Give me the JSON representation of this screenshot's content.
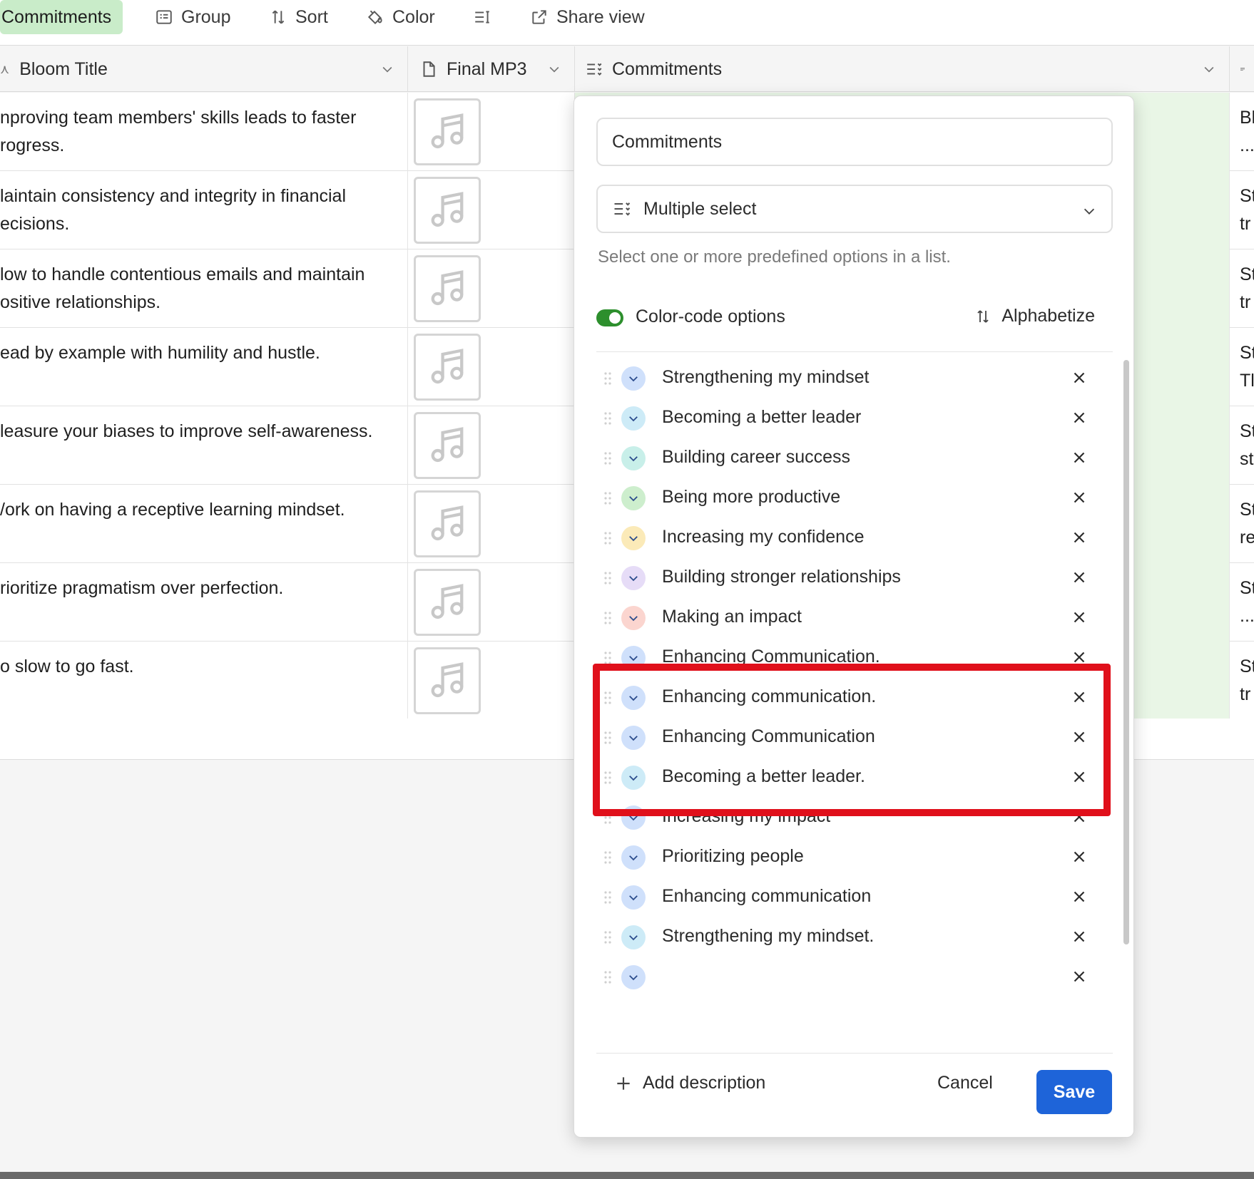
{
  "toolbar": {
    "items": [
      {
        "label": "Commitments",
        "icon": "none"
      },
      {
        "label": "Group",
        "icon": "group-icon"
      },
      {
        "label": "Sort",
        "icon": "sort-icon"
      },
      {
        "label": "Color",
        "icon": "paint-bucket-icon"
      },
      {
        "label": "",
        "icon": "row-height-icon"
      },
      {
        "label": "Share view",
        "icon": "share-icon"
      }
    ]
  },
  "columns": [
    {
      "label": "Bloom Title"
    },
    {
      "label": "Final MP3"
    },
    {
      "label": "Commitments"
    }
  ],
  "rows": [
    {
      "title_line1": "nproving team members' skills leads to faster",
      "title_line2": "rogress.",
      "next_line1": "Bl",
      "next_line2": "..."
    },
    {
      "title_line1": "laintain consistency and integrity in financial",
      "title_line2": "ecisions.",
      "next_line1": "St",
      "next_line2": "tr"
    },
    {
      "title_line1": "low to handle contentious emails and maintain",
      "title_line2": "ositive relationships.",
      "next_line1": "St",
      "next_line2": "tr"
    },
    {
      "title_line1": "ead by example with humility and hustle.",
      "title_line2": "",
      "next_line1": "St",
      "next_line2": "Tl"
    },
    {
      "title_line1": "leasure your biases to improve self-awareness.",
      "title_line2": "",
      "next_line1": "St",
      "next_line2": "st"
    },
    {
      "title_line1": "/ork on having a receptive learning mindset.",
      "title_line2": "",
      "next_line1": "St",
      "next_line2": "re"
    },
    {
      "title_line1": "rioritize pragmatism over perfection.",
      "title_line2": "",
      "next_line1": "St",
      "next_line2": "..."
    },
    {
      "title_line1": "o slow to go fast.",
      "title_line2": "",
      "next_line1": "St",
      "next_line2": "tr"
    }
  ],
  "panel": {
    "field_name": "Commitments",
    "field_type": "Multiple select",
    "type_description": "Select one or more predefined options in a list.",
    "color_code_label": "Color-code options",
    "color_code_on": true,
    "alphabetize_label": "Alphabetize",
    "options": [
      {
        "label": "Strengthening my mindset",
        "color": "#cfe0fb"
      },
      {
        "label": "Becoming a better leader",
        "color": "#cdebf7"
      },
      {
        "label": "Building career success",
        "color": "#c8efe9"
      },
      {
        "label": "Being more productive",
        "color": "#cdeecd"
      },
      {
        "label": "Increasing my confidence",
        "color": "#fbeab8"
      },
      {
        "label": "Building stronger relationships",
        "color": "#e6dcf7"
      },
      {
        "label": "Making an impact",
        "color": "#fbd5cf"
      },
      {
        "label": "Enhancing Communication.",
        "color": "#cfe0fb"
      },
      {
        "label": "Enhancing communication.",
        "color": "#cfe0fb"
      },
      {
        "label": "Enhancing Communication",
        "color": "#cfe0fb"
      },
      {
        "label": "Becoming a better leader.",
        "color": "#cdebf7"
      },
      {
        "label": "Increasing my impact",
        "color": "#cfe0fb"
      },
      {
        "label": "Prioritizing people",
        "color": "#cfe0fb"
      },
      {
        "label": "Enhancing communication",
        "color": "#cfe0fb"
      },
      {
        "label": "Strengthening my mindset.",
        "color": "#cdebf7"
      },
      {
        "label": "",
        "color": "#cfe0fb"
      }
    ],
    "add_description_label": "Add description",
    "cancel_label": "Cancel",
    "save_label": "Save"
  },
  "colors": {
    "active_tab": "#c9ecc9",
    "save_button": "#1e64d9",
    "highlight": "#e0101b",
    "toggle_on": "#2d8f2d"
  }
}
